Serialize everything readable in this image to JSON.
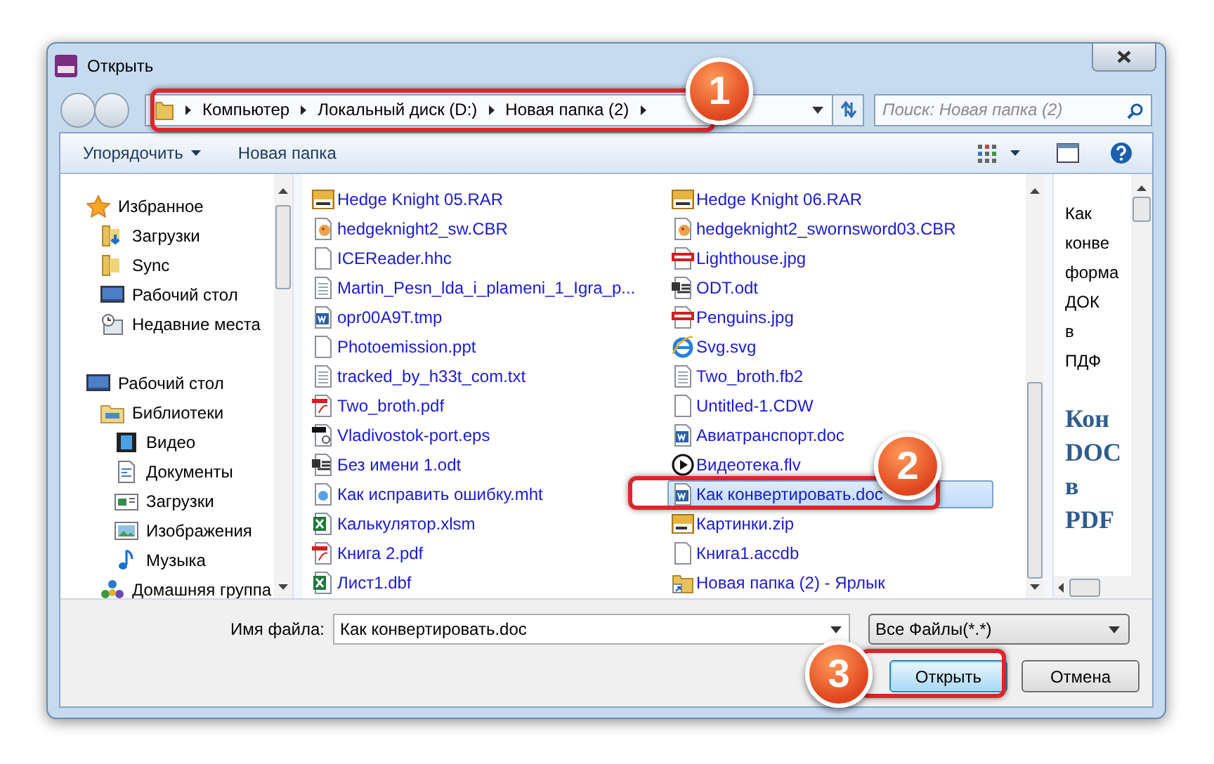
{
  "window": {
    "title": "Открыть"
  },
  "address": {
    "crumbs": [
      "Компьютер",
      "Локальный диск (D:)",
      "Новая папка (2)"
    ],
    "search_placeholder": "Поиск: Новая папка (2)"
  },
  "toolbar": {
    "organize": "Упорядочить",
    "new_folder": "Новая папка"
  },
  "sidebar": [
    {
      "label": "Избранное",
      "kind": "star",
      "children": [
        {
          "label": "Загрузки",
          "kind": "downloads"
        },
        {
          "label": "Sync",
          "kind": "folder"
        },
        {
          "label": "Рабочий стол",
          "kind": "desktop"
        },
        {
          "label": "Недавние места",
          "kind": "recent"
        }
      ]
    },
    {
      "label": "Рабочий стол",
      "kind": "desktop",
      "children": [
        {
          "label": "Библиотеки",
          "kind": "library",
          "children": [
            {
              "label": "Видео",
              "kind": "video"
            },
            {
              "label": "Документы",
              "kind": "document"
            },
            {
              "label": "Загрузки",
              "kind": "picture-doc"
            },
            {
              "label": "Изображения",
              "kind": "image"
            },
            {
              "label": "Музыка",
              "kind": "music"
            }
          ]
        },
        {
          "label": "Домашняя группа",
          "kind": "homegroup"
        }
      ]
    }
  ],
  "files": [
    {
      "name": "Hedge Knight 05.RAR",
      "kind": "rar",
      "selected": false
    },
    {
      "name": "hedgeknight2_sw.CBR",
      "kind": "cbr",
      "selected": false
    },
    {
      "name": "ICEReader.hhc",
      "kind": "blank",
      "selected": false
    },
    {
      "name": "Martin_Pesn_lda_i_plameni_1_Igra_p...",
      "kind": "text",
      "selected": false
    },
    {
      "name": "opr00A9T.tmp",
      "kind": "word",
      "selected": false
    },
    {
      "name": "Photoemission.ppt",
      "kind": "blank",
      "selected": false
    },
    {
      "name": "tracked_by_h33t_com.txt",
      "kind": "text",
      "selected": false
    },
    {
      "name": "Two_broth.pdf",
      "kind": "pdf",
      "selected": false
    },
    {
      "name": "Vladivostok-port.eps",
      "kind": "eps",
      "selected": false
    },
    {
      "name": "Без имени 1.odt",
      "kind": "odt",
      "selected": false
    },
    {
      "name": "Как исправить ошибку.mht",
      "kind": "mht",
      "selected": false
    },
    {
      "name": "Калькулятор.xlsm",
      "kind": "excel",
      "selected": false
    },
    {
      "name": "Книга 2.pdf",
      "kind": "pdf",
      "selected": false
    },
    {
      "name": "Лист1.dbf",
      "kind": "excel",
      "selected": false
    },
    {
      "name": "Hedge Knight 06.RAR",
      "kind": "rar",
      "selected": false
    },
    {
      "name": "hedgeknight2_swornsword03.CBR",
      "kind": "cbr",
      "selected": false
    },
    {
      "name": "Lighthouse.jpg",
      "kind": "jpg",
      "selected": false
    },
    {
      "name": "ODT.odt",
      "kind": "odt",
      "selected": false
    },
    {
      "name": "Penguins.jpg",
      "kind": "jpg",
      "selected": false
    },
    {
      "name": "Svg.svg",
      "kind": "ie",
      "selected": false
    },
    {
      "name": "Two_broth.fb2",
      "kind": "text",
      "selected": false
    },
    {
      "name": "Untitled-1.CDW",
      "kind": "blank",
      "selected": false
    },
    {
      "name": "Авиатранспорт.doc",
      "kind": "word",
      "selected": false
    },
    {
      "name": "Видеотека.flv",
      "kind": "flv",
      "selected": false
    },
    {
      "name": "Как конвертировать.doc",
      "kind": "word",
      "selected": true
    },
    {
      "name": "Картинки.zip",
      "kind": "zip",
      "selected": false
    },
    {
      "name": "Книга1.accdb",
      "kind": "blank",
      "selected": false
    },
    {
      "name": "Новая папка (2) - Ярлык",
      "kind": "shortcut",
      "selected": false
    }
  ],
  "preview": [
    {
      "text": "Как",
      "kind": "plain"
    },
    {
      "text": "конве",
      "kind": "plain"
    },
    {
      "text": "форма",
      "kind": "plain"
    },
    {
      "text": "ДОК",
      "kind": "plain"
    },
    {
      "text": "в",
      "kind": "plain"
    },
    {
      "text": "ПДФ",
      "kind": "plain"
    },
    {
      "text": "Кон",
      "kind": "heading"
    },
    {
      "text": "DOC",
      "kind": "heading"
    },
    {
      "text": "в",
      "kind": "heading"
    },
    {
      "text": "PDF",
      "kind": "heading"
    }
  ],
  "bottom": {
    "filename_label": "Имя файла:",
    "filename": "Как конвертировать.doc",
    "filetype": "Все Файлы(*.*)",
    "open": "Открыть",
    "cancel": "Отмена"
  },
  "callouts": [
    "1",
    "2",
    "3"
  ]
}
